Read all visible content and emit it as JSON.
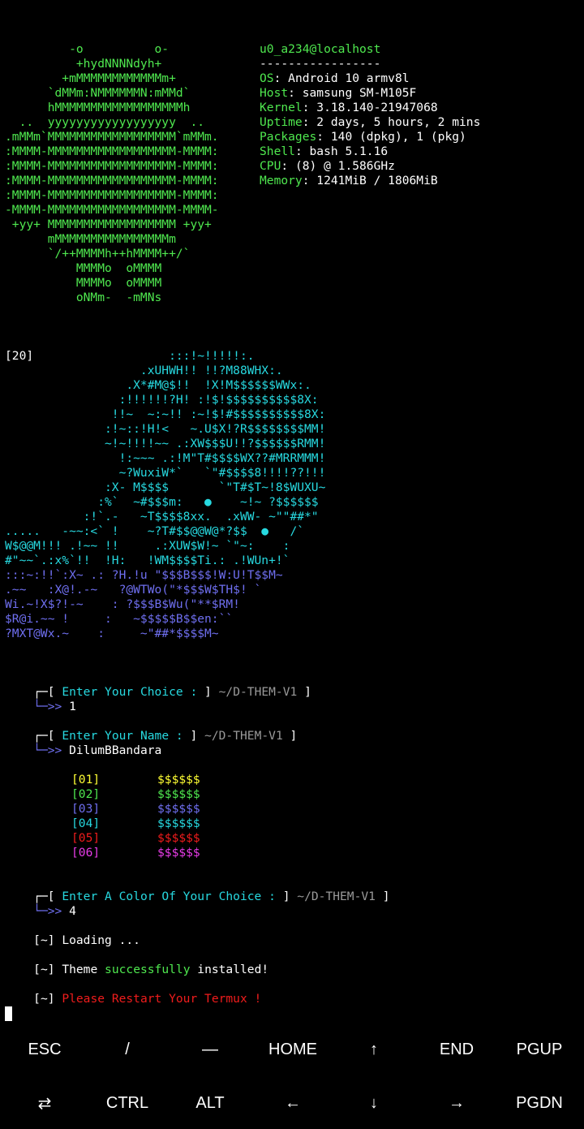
{
  "colors": {
    "green": "#4fe84f",
    "cyan": "#27d9e0",
    "blue": "#6f6ff0",
    "red": "#f01c1c",
    "yellow": "#ffff33",
    "magenta": "#e83ce8",
    "gray": "#9a9a9a"
  },
  "neofetch": {
    "logo": [
      "         -o          o-",
      "          +hydNNNNdyh+",
      "        +mMMMMMMMMMMMMm+",
      "      `dMMm:NMMMMMMN:mMMd`",
      "      hMMMMMMMMMMMMMMMMMMh",
      "  ..  yyyyyyyyyyyyyyyyyy  ..",
      ".mMMm`MMMMMMMMMMMMMMMMMM`mMMm.",
      ":MMMM-MMMMMMMMMMMMMMMMMM-MMMM:",
      ":MMMM-MMMMMMMMMMMMMMMMMM-MMMM:",
      ":MMMM-MMMMMMMMMMMMMMMMMM-MMMM:",
      ":MMMM-MMMMMMMMMMMMMMMMMM-MMMM:",
      "-MMMM-MMMMMMMMMMMMMMMMMM-MMMM-",
      " +yy+ MMMMMMMMMMMMMMMMMM +yy+",
      "      mMMMMMMMMMMMMMMMMm",
      "      `/++MMMMh++hMMMM++/`",
      "          MMMMo  oMMMM",
      "          MMMMo  oMMMM",
      "          oNMm-  -mMNs"
    ],
    "user_host": "u0_a234@localhost",
    "separator": "-----------------",
    "info": [
      {
        "key": "OS",
        "value": "Android 10 armv8l"
      },
      {
        "key": "Host",
        "value": "samsung SM-M105F"
      },
      {
        "key": "Kernel",
        "value": "3.18.140-21947068"
      },
      {
        "key": "Uptime",
        "value": "2 days, 5 hours, 2 mins"
      },
      {
        "key": "Packages",
        "value": "140 (dpkg), 1 (pkg)"
      },
      {
        "key": "Shell",
        "value": "bash 5.1.16"
      },
      {
        "key": "CPU",
        "value": "(8) @ 1.586GHz"
      },
      {
        "key": "Memory",
        "value": "1241MiB / 1806MiB"
      }
    ]
  },
  "art": {
    "tag": "[20]",
    "cyan_lines": [
      "                       :::!~!!!!!:.",
      "                   .xUHWH!! !!?M88WHX:.",
      "                 .X*#M@$!!  !X!M$$$$$$WWx:.",
      "                :!!!!!!?H! :!$!$$$$$$$$$$8X:",
      "               !!~  ~:~!! :~!$!#$$$$$$$$$$8X:",
      "              :!~::!H!<   ~.U$X!?R$$$$$$$$MM!",
      "              ~!~!!!!~~ .:XW$$$U!!?$$$$$$RMM!",
      "                !:~~~ .:!M\"T#$$$$WX??#MRRMMM!",
      "                ~?WuxiW*`   `\"#$$$$8!!!!??!!!",
      "              :X- M$$$$       `\"T#$T~!8$WUXU~",
      "             :%`  ~#$$$m:   ●    ~!~ ?$$$$$$",
      "           :!`.-   ~T$$$$8xx.  .xWW- ~\"\"##*\"",
      ".....   -~~:<` !    ~?T#$$@@W@*?$$  ●   /`",
      "W$@@M!!! .!~~ !!     .:XUW$W!~ `\"~:    :",
      "#\"~~`.:x%`!!  !H:   !WM$$$$Ti.: .!WUn+!`"
    ],
    "blue_lines": [
      ":::~:!!`:X~ .: ?H.!u \"$$$B$$$!W:U!T$$M~",
      ".~~   :X@!.-~   ?@WTWo(\"*$$$W$TH$! `",
      "Wi.~!X$?!-~    : ?$$$B$Wu(\"**$RM!",
      "$R@i.~~ !     :   ~$$$$$B$$en:``",
      "?MXT@Wx.~    :     ~\"##*$$$$M~"
    ]
  },
  "prompts": [
    {
      "label": "Enter Your Choice :",
      "path": "~/D-THEM-V1",
      "input": "1"
    },
    {
      "label": "Enter Your Name :",
      "path": "~/D-THEM-V1",
      "input": "DilumBBandara"
    },
    {
      "label": "Enter A Color Of Your Choice :",
      "path": "~/D-THEM-V1",
      "input": "4"
    }
  ],
  "color_options": [
    {
      "num": "[01]",
      "sample": "$$$$$$",
      "color": "#ffff33"
    },
    {
      "num": "[02]",
      "sample": "$$$$$$",
      "color": "#4fe84f"
    },
    {
      "num": "[03]",
      "sample": "$$$$$$",
      "color": "#6f6ff0"
    },
    {
      "num": "[04]",
      "sample": "$$$$$$",
      "color": "#27d9e0"
    },
    {
      "num": "[05]",
      "sample": "$$$$$$",
      "color": "#f01c1c"
    },
    {
      "num": "[06]",
      "sample": "$$$$$$",
      "color": "#e83ce8"
    }
  ],
  "status": {
    "marker": "[~]",
    "loading": "Loading ...",
    "theme_word": "Theme",
    "success_word": "successfully",
    "installed": "installed!",
    "restart": "Please Restart Your Termux !"
  },
  "prompt_glyphs": {
    "top": "┌─[",
    "close": "]",
    "arrow": "└─>>"
  },
  "extra_keys": {
    "row1": [
      "ESC",
      "/",
      "—",
      "HOME",
      "↑",
      "END",
      "PGUP"
    ],
    "row2": [
      "⇄",
      "CTRL",
      "ALT",
      "←",
      "↓",
      "→",
      "PGDN"
    ]
  }
}
